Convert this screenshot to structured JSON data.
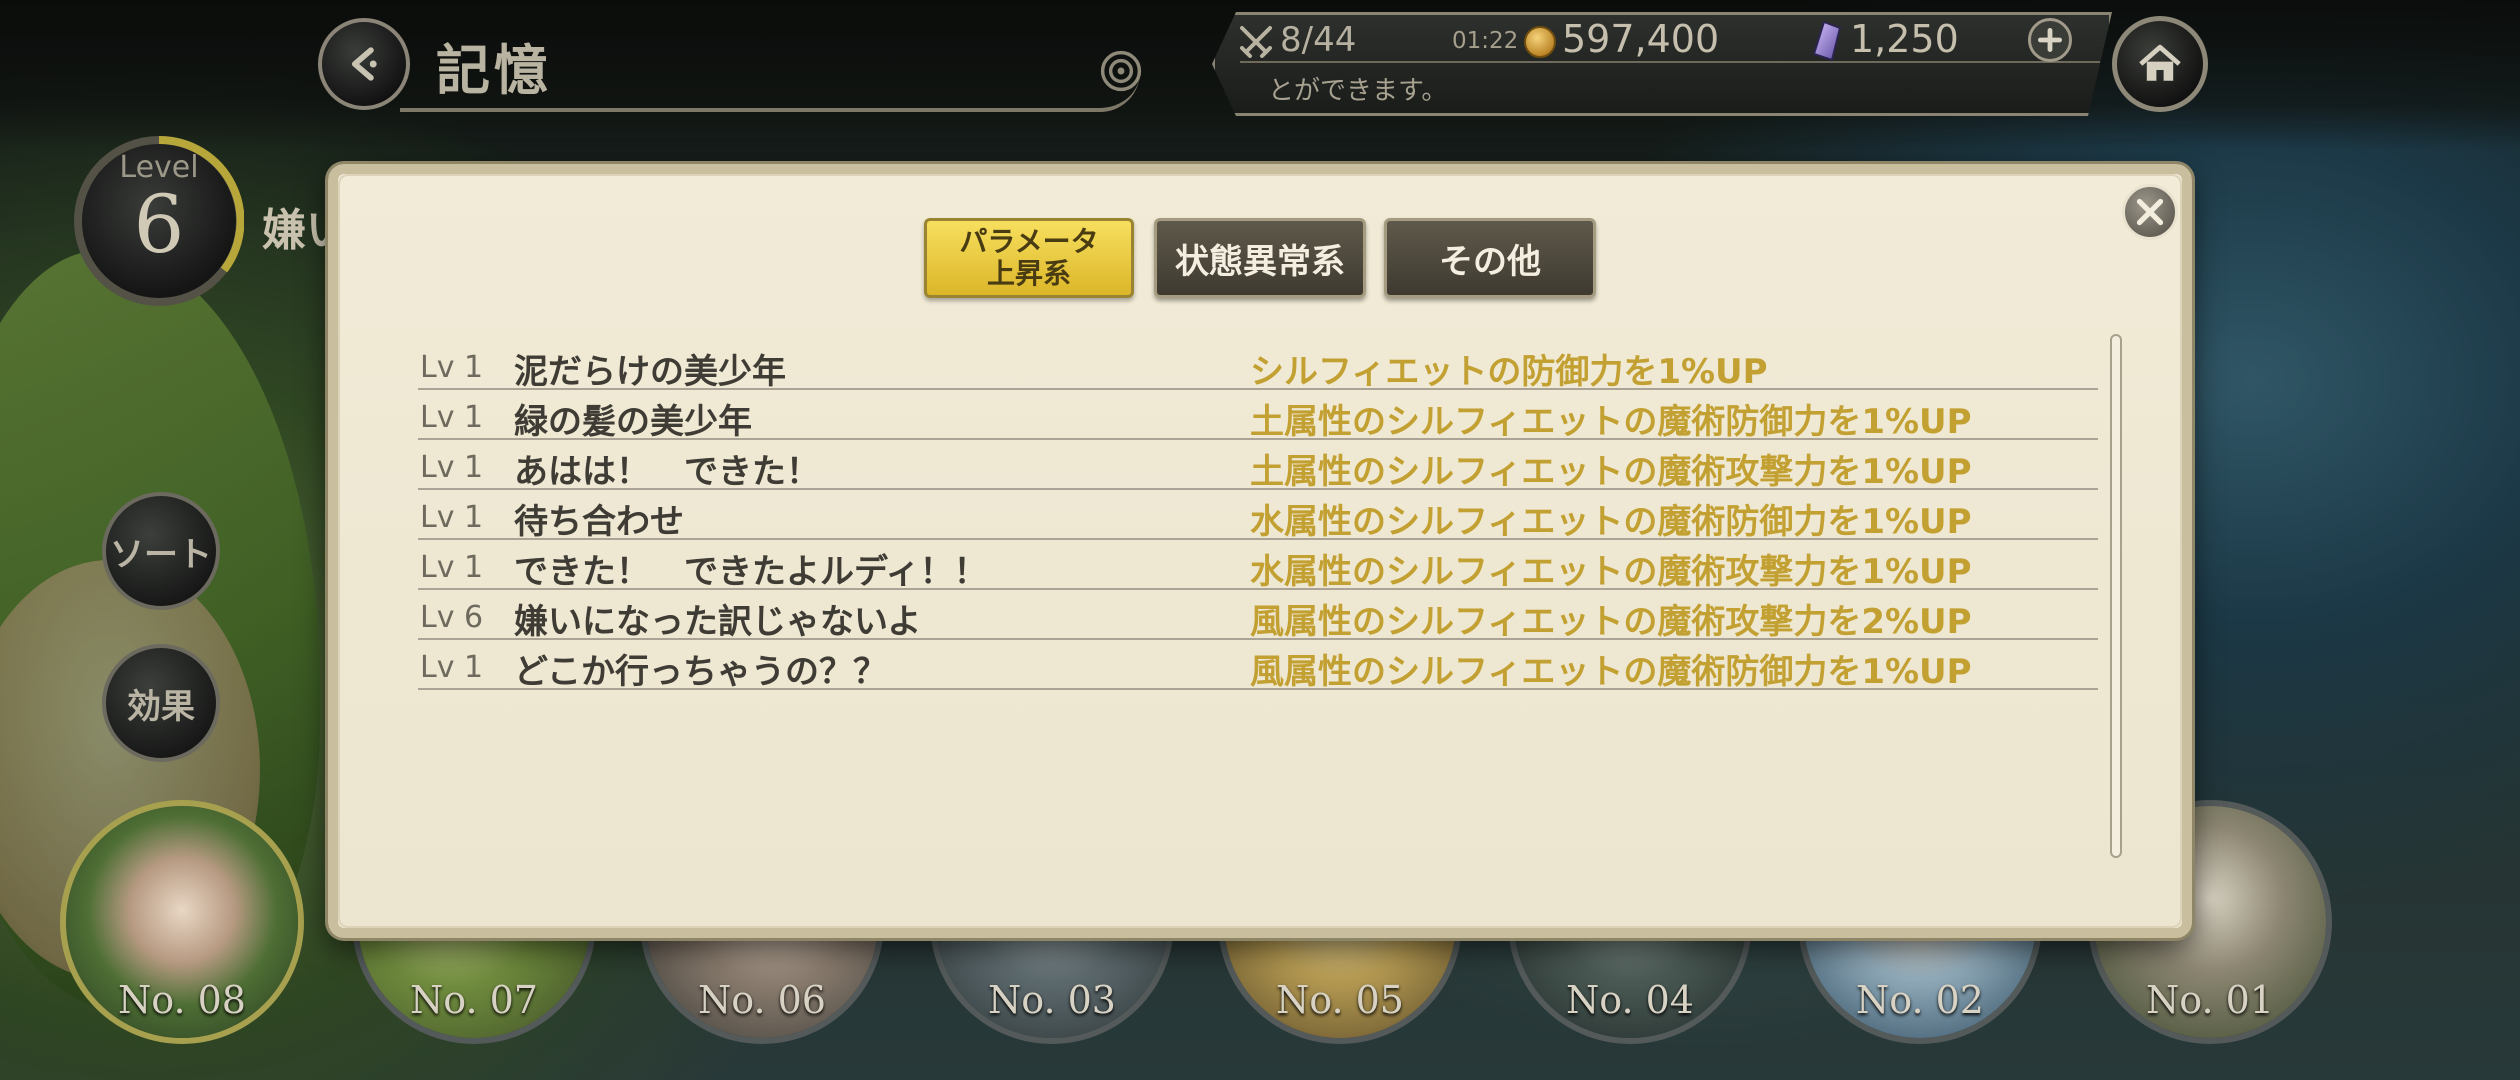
{
  "header": {
    "title": "記憶",
    "stamina": "8/44",
    "timer": "01:22",
    "coins": "597,400",
    "gems": "1,250",
    "ticker": "とができます。"
  },
  "level": {
    "label": "Level",
    "value": "6"
  },
  "memory_name_peek": "嫌い",
  "side_buttons": {
    "sort": "ソート",
    "effect": "効果"
  },
  "tabs": {
    "parameter_line1": "パラメータ",
    "parameter_line2": "上昇系",
    "status": "状態異常系",
    "other": "その他"
  },
  "effects": [
    {
      "lv": "Lv 1",
      "name": "泥だらけの美少年",
      "effect": "シルフィエットの防御力を1%UP"
    },
    {
      "lv": "Lv 1",
      "name": "緑の髪の美少年",
      "effect": "土属性のシルフィエットの魔術防御力を1%UP"
    },
    {
      "lv": "Lv 1",
      "name": "あはは！　できた！",
      "effect": "土属性のシルフィエットの魔術攻撃力を1%UP"
    },
    {
      "lv": "Lv 1",
      "name": "待ち合わせ",
      "effect": "水属性のシルフィエットの魔術防御力を1%UP"
    },
    {
      "lv": "Lv 1",
      "name": "できた！　できたよルディ！！",
      "effect": "水属性のシルフィエットの魔術攻撃力を1%UP"
    },
    {
      "lv": "Lv 6",
      "name": "嫌いになった訳じゃないよ",
      "effect": "風属性のシルフィエットの魔術攻撃力を2%UP"
    },
    {
      "lv": "Lv 1",
      "name": "どこか行っちゃうの？？",
      "effect": "風属性のシルフィエットの魔術防御力を1%UP"
    }
  ],
  "portraits": [
    "No. 08",
    "No. 07",
    "No. 06",
    "No. 03",
    "No. 05",
    "No. 04",
    "No. 02",
    "No. 01"
  ],
  "colors": {
    "accent_gold": "#c3a032",
    "active_tab": "#f0d24a",
    "panel": "#efe9d4"
  }
}
